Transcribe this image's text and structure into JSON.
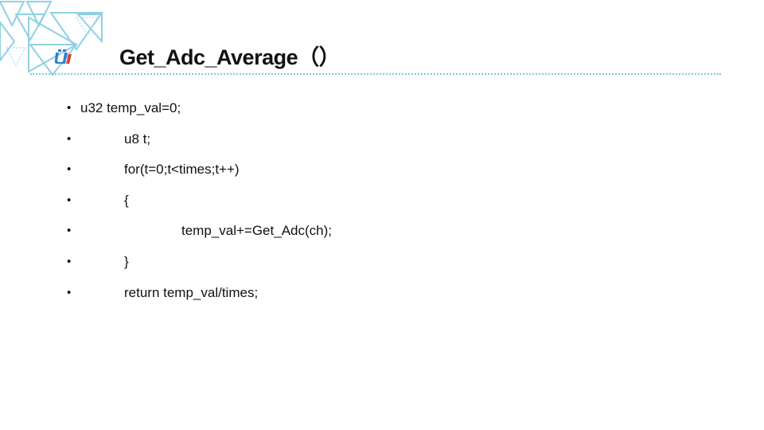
{
  "slide": {
    "title": "Get_Adc_Average（）",
    "bullet_symbol": "•",
    "lines": [
      "u32 temp_val=0;",
      "u8 t;",
      "for(t=0;t<times;t++)",
      "{",
      "temp_val+=Get_Adc(ch);",
      "}",
      "return temp_val/times;"
    ]
  },
  "logo": {
    "icon": "stylized-u-logo-icon",
    "colors": [
      "#2a7fd0",
      "#e23a3a"
    ]
  },
  "decoration": {
    "icon": "triangle-pattern-icon",
    "color": "#7ec8dd"
  }
}
